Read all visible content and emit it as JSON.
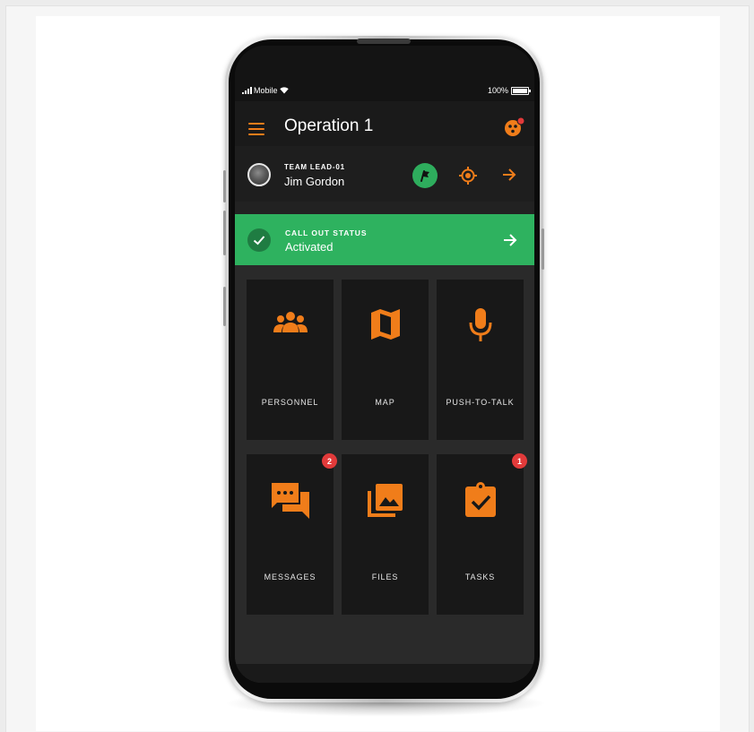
{
  "status_bar": {
    "carrier": "Mobile",
    "battery": "100%"
  },
  "app_bar": {
    "title": "Operation 1"
  },
  "user": {
    "role": "TEAM LEAD-01",
    "name": "Jim Gordon"
  },
  "callout": {
    "label": "CALL OUT STATUS",
    "value": "Activated"
  },
  "tiles": [
    {
      "label": "PERSONNEL",
      "icon": "group-icon"
    },
    {
      "label": "MAP",
      "icon": "map-icon"
    },
    {
      "label": "PUSH-TO-TALK",
      "icon": "microphone-icon"
    },
    {
      "label": "MESSAGES",
      "icon": "chat-icon",
      "badge": "2"
    },
    {
      "label": "FILES",
      "icon": "photo-library-icon"
    },
    {
      "label": "TASKS",
      "icon": "clipboard-check-icon",
      "badge": "1"
    }
  ],
  "colors": {
    "accent": "#f07d1a",
    "success": "#2eb25f",
    "badge": "#e23a3a",
    "tile_bg": "#181818"
  }
}
